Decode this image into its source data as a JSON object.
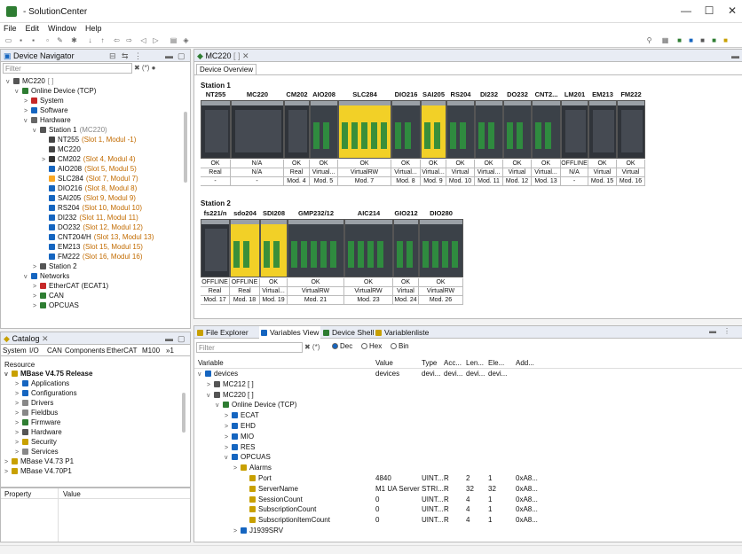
{
  "app": {
    "title": "- SolutionCenter"
  },
  "window": {
    "minimize": "—",
    "maximize": "☐",
    "close": "✕"
  },
  "menu": [
    "File",
    "Edit",
    "Window",
    "Help"
  ],
  "nav": {
    "tab": "Device Navigator",
    "filter_placeholder": "Filter",
    "filter_icons": "✖ (*) ●"
  },
  "nav_tree": [
    {
      "label": "MC220",
      "suffix": "[         ]",
      "depth": 0,
      "tw": "v",
      "icon": "#555",
      "color": ""
    },
    {
      "label": "Online Device (TCP)",
      "suffix": "",
      "depth": 1,
      "tw": "v",
      "icon": "#2e7d32",
      "color": ""
    },
    {
      "label": "System",
      "suffix": "",
      "depth": 2,
      "tw": ">",
      "icon": "#c62828",
      "color": ""
    },
    {
      "label": "Software",
      "suffix": "",
      "depth": 2,
      "tw": ">",
      "icon": "#1565c0",
      "color": ""
    },
    {
      "label": "Hardware",
      "suffix": "",
      "depth": 2,
      "tw": "v",
      "icon": "#666",
      "color": ""
    },
    {
      "label": "Station 1",
      "suffix": "(MC220)",
      "depth": 3,
      "tw": "v",
      "icon": "#555",
      "color": ""
    },
    {
      "label": "NT255",
      "suffix": "(Slot 1, Modul -1)",
      "depth": 4,
      "tw": "",
      "icon": "#444",
      "color": "orange"
    },
    {
      "label": "MC220",
      "suffix": "",
      "depth": 4,
      "tw": "",
      "icon": "#444",
      "color": ""
    },
    {
      "label": "CM202",
      "suffix": "(Slot 4, Modul 4)",
      "depth": 4,
      "tw": ">",
      "icon": "#333",
      "color": "orange"
    },
    {
      "label": "AIO208",
      "suffix": "(Slot 5, Modul 5)",
      "depth": 4,
      "tw": "",
      "icon": "#1565c0",
      "color": "orange"
    },
    {
      "label": "SLC284",
      "suffix": "(Slot 7, Modul 7)",
      "depth": 4,
      "tw": "",
      "icon": "#f9a825",
      "color": "orange"
    },
    {
      "label": "DIO216",
      "suffix": "(Slot 8, Modul 8)",
      "depth": 4,
      "tw": "",
      "icon": "#1565c0",
      "color": "orange"
    },
    {
      "label": "SAI205",
      "suffix": "(Slot 9, Modul 9)",
      "depth": 4,
      "tw": "",
      "icon": "#1565c0",
      "color": "orange"
    },
    {
      "label": "RS204",
      "suffix": "(Slot 10, Modul 10)",
      "depth": 4,
      "tw": "",
      "icon": "#1565c0",
      "color": "orange"
    },
    {
      "label": "DI232",
      "suffix": "(Slot 11, Modul 11)",
      "depth": 4,
      "tw": "",
      "icon": "#1565c0",
      "color": "orange"
    },
    {
      "label": "DO232",
      "suffix": "(Slot 12, Modul 12)",
      "depth": 4,
      "tw": "",
      "icon": "#1565c0",
      "color": "orange"
    },
    {
      "label": "CNT204/H",
      "suffix": "(Slot 13, Modul 13)",
      "depth": 4,
      "tw": "",
      "icon": "#1565c0",
      "color": "orange"
    },
    {
      "label": "EM213",
      "suffix": "(Slot 15, Modul 15)",
      "depth": 4,
      "tw": "",
      "icon": "#1565c0",
      "color": "orange"
    },
    {
      "label": "FM222",
      "suffix": "(Slot 16, Modul 16)",
      "depth": 4,
      "tw": "",
      "icon": "#1565c0",
      "color": "orange"
    },
    {
      "label": "Station 2",
      "suffix": "",
      "depth": 3,
      "tw": ">",
      "icon": "#555",
      "color": ""
    },
    {
      "label": "Networks",
      "suffix": "",
      "depth": 2,
      "tw": "v",
      "icon": "#1565c0",
      "color": ""
    },
    {
      "label": "EtherCAT (ECAT1)",
      "suffix": "",
      "depth": 3,
      "tw": ">",
      "icon": "#c62828",
      "color": ""
    },
    {
      "label": "CAN",
      "suffix": "",
      "depth": 3,
      "tw": ">",
      "icon": "#2e7d32",
      "color": ""
    },
    {
      "label": "OPCUAS",
      "suffix": "",
      "depth": 3,
      "tw": ">",
      "icon": "#2e7d32",
      "color": ""
    }
  ],
  "catalog": {
    "tab": "Catalog",
    "subtabs": [
      "System",
      "I/O",
      "CAN",
      "Components",
      "EtherCAT",
      "M100",
      "»1"
    ],
    "header": "Resource",
    "items": [
      {
        "label": "MBase V4.75 Release",
        "depth": 0,
        "tw": "v",
        "bold": true,
        "icon": "#c8a000"
      },
      {
        "label": "Applications",
        "depth": 1,
        "tw": ">",
        "bold": false,
        "icon": "#1565c0"
      },
      {
        "label": "Configurations",
        "depth": 1,
        "tw": ">",
        "bold": false,
        "icon": "#1565c0"
      },
      {
        "label": "Drivers",
        "depth": 1,
        "tw": ">",
        "bold": false,
        "icon": "#888"
      },
      {
        "label": "Fieldbus",
        "depth": 1,
        "tw": ">",
        "bold": false,
        "icon": "#888"
      },
      {
        "label": "Firmware",
        "depth": 1,
        "tw": ">",
        "bold": false,
        "icon": "#2e7d32"
      },
      {
        "label": "Hardware",
        "depth": 1,
        "tw": ">",
        "bold": false,
        "icon": "#555"
      },
      {
        "label": "Security",
        "depth": 1,
        "tw": ">",
        "bold": false,
        "icon": "#c8a000"
      },
      {
        "label": "Services",
        "depth": 1,
        "tw": ">",
        "bold": false,
        "icon": "#888"
      },
      {
        "label": "MBase V4.73 P1",
        "depth": 0,
        "tw": ">",
        "bold": false,
        "icon": "#c8a000"
      },
      {
        "label": "MBase V4.70P1",
        "depth": 0,
        "tw": ">",
        "bold": false,
        "icon": "#c8a000"
      }
    ]
  },
  "properties": {
    "col1": "Property",
    "col2": "Value"
  },
  "editor": {
    "tab": "MC220",
    "tab_suffix": "[          ]",
    "subtab": "Device Overview",
    "station1": {
      "title": "Station 1",
      "modules": [
        {
          "name": "NT255",
          "status": "OK",
          "type": "Real",
          "mod": "-",
          "kind": "dark"
        },
        {
          "name": "MC220",
          "status": "N/A",
          "type": "N/A",
          "mod": "-",
          "kind": "cpu"
        },
        {
          "name": "CM202",
          "status": "OK",
          "type": "Real",
          "mod": "Mod. 4",
          "kind": "dark"
        },
        {
          "name": "AIO208",
          "status": "OK",
          "type": "Virtual...",
          "mod": "Mod. 5",
          "kind": "io"
        },
        {
          "name": "SLC284",
          "status": "OK",
          "type": "VirtualRW",
          "mod": "Mod. 7",
          "kind": "yellow"
        },
        {
          "name": "DIO216",
          "status": "OK",
          "type": "Virtual...",
          "mod": "Mod. 8",
          "kind": "io"
        },
        {
          "name": "SAI205",
          "status": "OK",
          "type": "Virtual...",
          "mod": "Mod. 9",
          "kind": "yellow"
        },
        {
          "name": "RS204",
          "status": "OK",
          "type": "Virtual",
          "mod": "Mod. 10",
          "kind": "io"
        },
        {
          "name": "DI232",
          "status": "OK",
          "type": "Virtual...",
          "mod": "Mod. 11",
          "kind": "io"
        },
        {
          "name": "DO232",
          "status": "OK",
          "type": "Virtual",
          "mod": "Mod. 12",
          "kind": "io"
        },
        {
          "name": "CNT2...",
          "status": "OK",
          "type": "Virtual...",
          "mod": "Mod. 13",
          "kind": "io"
        },
        {
          "name": "LM201",
          "status": "OFFLINE",
          "type": "N/A",
          "mod": "-",
          "kind": "dark"
        },
        {
          "name": "EM213",
          "status": "OK",
          "type": "Virtual",
          "mod": "Mod. 15",
          "kind": "dark"
        },
        {
          "name": "FM222",
          "status": "OK",
          "type": "Virtual",
          "mod": "Mod. 16",
          "kind": "dark"
        }
      ]
    },
    "station2": {
      "title": "Station 2",
      "modules": [
        {
          "name": "fs221/n",
          "status": "OFFLINE",
          "type": "Real",
          "mod": "Mod. 17",
          "kind": "dark"
        },
        {
          "name": "sdo204",
          "status": "OFFLINE",
          "type": "Real",
          "mod": "Mod. 18",
          "kind": "yellow"
        },
        {
          "name": "SDI208",
          "status": "OK",
          "type": "Virtual...",
          "mod": "Mod. 19",
          "kind": "yellow"
        },
        {
          "name": "GMP232/12",
          "status": "OK",
          "type": "VirtualRW",
          "mod": "Mod. 21",
          "kind": "io"
        },
        {
          "name": "AIC214",
          "status": "OK",
          "type": "VirtualRW",
          "mod": "Mod. 23",
          "kind": "io"
        },
        {
          "name": "GIO212",
          "status": "OK",
          "type": "Virtual",
          "mod": "Mod. 24",
          "kind": "io"
        },
        {
          "name": "DIO280",
          "status": "OK",
          "type": "VirtualRW",
          "mod": "Mod. 26",
          "kind": "io"
        }
      ]
    }
  },
  "bottom": {
    "tabs": [
      "File Explorer",
      "Variables View",
      "Device Shell",
      "Variablenliste"
    ],
    "filter_placeholder": "Filter",
    "filter_icons": "✖ (*)",
    "radios": [
      "Dec",
      "Hex",
      "Bin"
    ],
    "columns": [
      "Variable",
      "Value",
      "Type",
      "Acc...",
      "Len...",
      "Ele...",
      "Add..."
    ],
    "rows": [
      {
        "label": "devices",
        "depth": 0,
        "tw": "v",
        "icon": "#1565c0",
        "value": "devices",
        "type": "devi...",
        "acc": "devi...",
        "len": "devi...",
        "ele": "devi...",
        "add": ""
      },
      {
        "label": "MC212 [          ]",
        "depth": 1,
        "tw": ">",
        "icon": "#555",
        "value": "",
        "type": "",
        "acc": "",
        "len": "",
        "ele": "",
        "add": ""
      },
      {
        "label": "MC220 [          ]",
        "depth": 1,
        "tw": "v",
        "icon": "#555",
        "value": "",
        "type": "",
        "acc": "",
        "len": "",
        "ele": "",
        "add": ""
      },
      {
        "label": "Online Device (TCP)",
        "depth": 2,
        "tw": "v",
        "icon": "#2e7d32",
        "value": "",
        "type": "",
        "acc": "",
        "len": "",
        "ele": "",
        "add": ""
      },
      {
        "label": "ECAT",
        "depth": 3,
        "tw": ">",
        "icon": "#1565c0",
        "value": "",
        "type": "",
        "acc": "",
        "len": "",
        "ele": "",
        "add": ""
      },
      {
        "label": "EHD",
        "depth": 3,
        "tw": ">",
        "icon": "#1565c0",
        "value": "",
        "type": "",
        "acc": "",
        "len": "",
        "ele": "",
        "add": ""
      },
      {
        "label": "MIO",
        "depth": 3,
        "tw": ">",
        "icon": "#1565c0",
        "value": "",
        "type": "",
        "acc": "",
        "len": "",
        "ele": "",
        "add": ""
      },
      {
        "label": "RES",
        "depth": 3,
        "tw": ">",
        "icon": "#1565c0",
        "value": "",
        "type": "",
        "acc": "",
        "len": "",
        "ele": "",
        "add": ""
      },
      {
        "label": "OPCUAS",
        "depth": 3,
        "tw": "v",
        "icon": "#1565c0",
        "value": "",
        "type": "",
        "acc": "",
        "len": "",
        "ele": "",
        "add": ""
      },
      {
        "label": "Alarms",
        "depth": 4,
        "tw": ">",
        "icon": "#c8a000",
        "value": "",
        "type": "",
        "acc": "",
        "len": "",
        "ele": "",
        "add": ""
      },
      {
        "label": "Port",
        "depth": 5,
        "tw": "",
        "icon": "#c8a000",
        "value": "4840",
        "type": "UINT...",
        "acc": "R",
        "len": "2",
        "ele": "1",
        "add": "0xA8..."
      },
      {
        "label": "ServerName",
        "depth": 5,
        "tw": "",
        "icon": "#c8a000",
        "value": "M1 UA Server",
        "type": "STRI...",
        "acc": "R",
        "len": "32",
        "ele": "32",
        "add": "0xA8..."
      },
      {
        "label": "SessionCount",
        "depth": 5,
        "tw": "",
        "icon": "#c8a000",
        "value": "0",
        "type": "UINT...",
        "acc": "R",
        "len": "4",
        "ele": "1",
        "add": "0xA8..."
      },
      {
        "label": "SubscriptionCount",
        "depth": 5,
        "tw": "",
        "icon": "#c8a000",
        "value": "0",
        "type": "UINT...",
        "acc": "R",
        "len": "4",
        "ele": "1",
        "add": "0xA8..."
      },
      {
        "label": "SubscriptionItemCount",
        "depth": 5,
        "tw": "",
        "icon": "#c8a000",
        "value": "0",
        "type": "UINT...",
        "acc": "R",
        "len": "4",
        "ele": "1",
        "add": "0xA8..."
      },
      {
        "label": "J1939SRV",
        "depth": 4,
        "tw": ">",
        "icon": "#1565c0",
        "value": "",
        "type": "",
        "acc": "",
        "len": "",
        "ele": "",
        "add": ""
      }
    ]
  }
}
